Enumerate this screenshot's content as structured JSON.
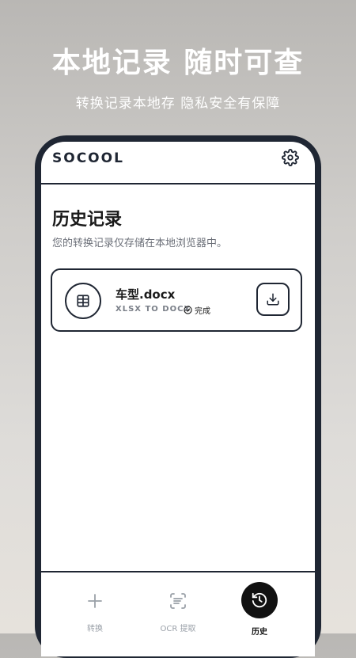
{
  "promo": {
    "title": "本地记录 随时可查",
    "subtitle": "转换记录本地存 隐私安全有保障"
  },
  "app": {
    "brand": "SOCOOL",
    "settings_icon": "gear-icon"
  },
  "history": {
    "title": "历史记录",
    "description": "您的转换记录仅存储在本地浏览器中。",
    "items": [
      {
        "file_name": "车型.docx",
        "conversion": "XLSX TO DOCX",
        "status": "完成",
        "icon": "table-icon",
        "action_icon": "download-icon"
      }
    ]
  },
  "nav": {
    "items": [
      {
        "label": "转换",
        "icon": "plus-icon",
        "active": false
      },
      {
        "label": "OCR 提取",
        "icon": "scan-text-icon",
        "active": false
      },
      {
        "label": "历史",
        "icon": "history-icon",
        "active": true
      }
    ]
  },
  "colors": {
    "frame": "#1f2633",
    "inactive": "#9aa0a8",
    "active": "#111111",
    "muted_text": "#6b6f78"
  }
}
